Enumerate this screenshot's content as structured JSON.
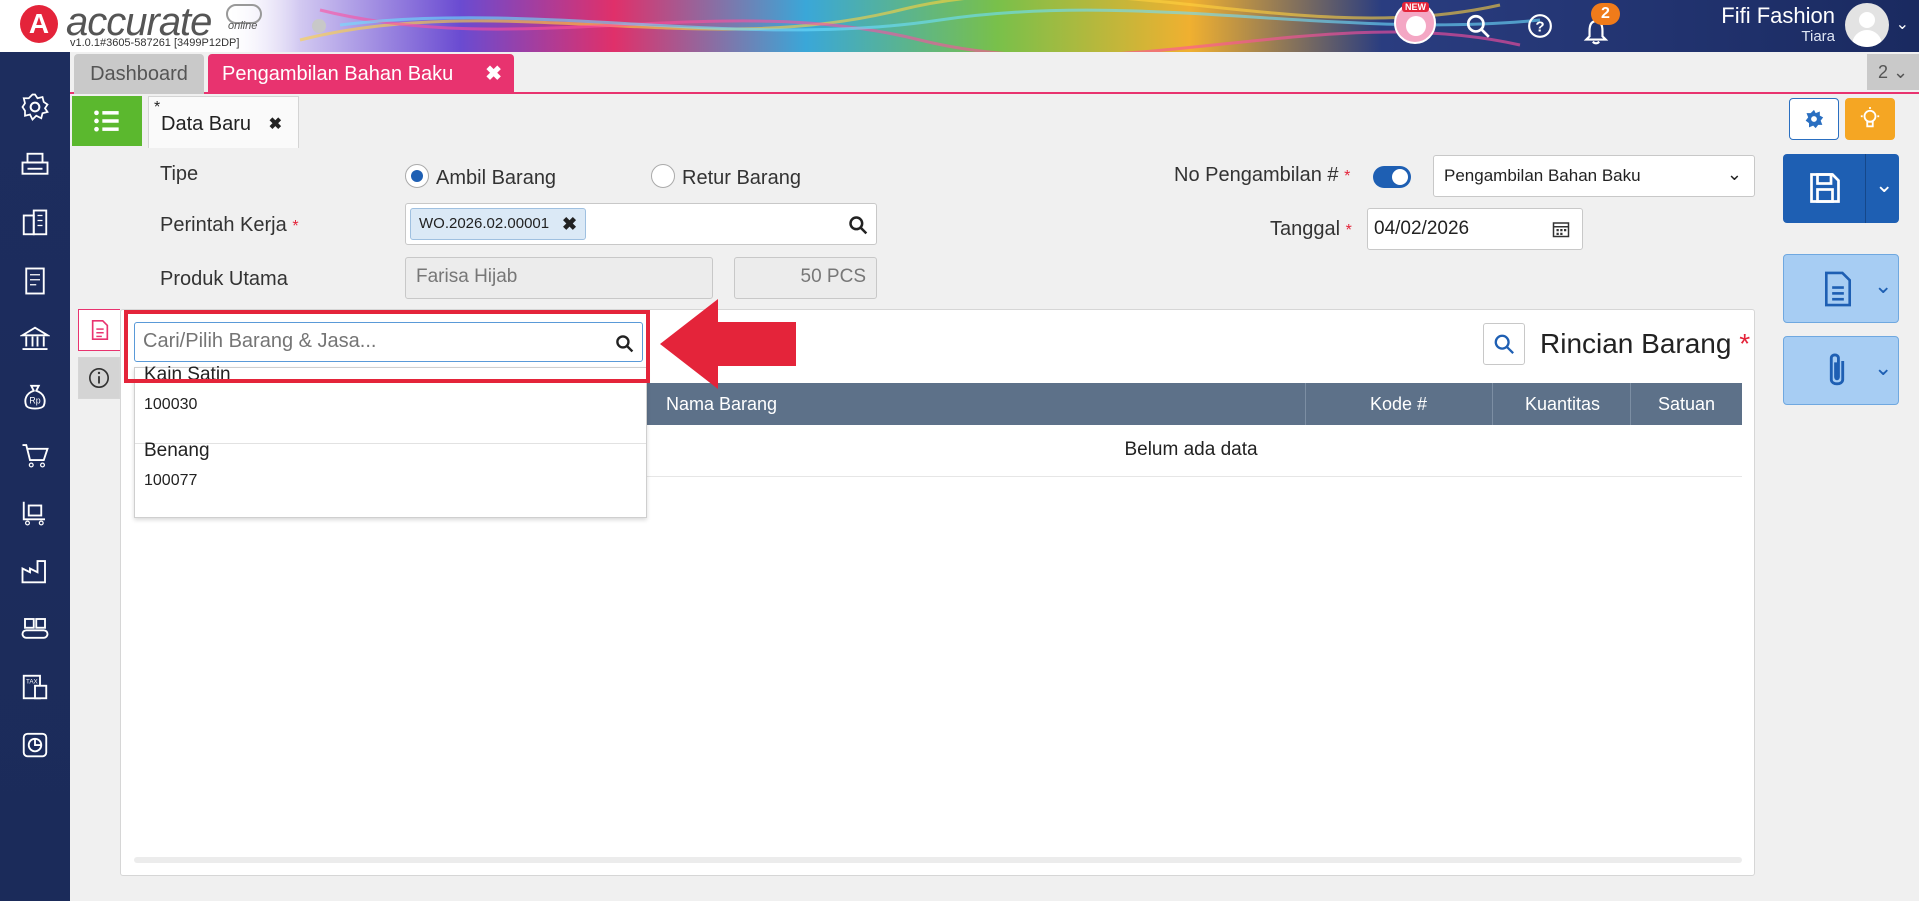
{
  "header": {
    "logo_text": "accurate",
    "logo_sub": "online",
    "version": "v1.0.1#3605-587261 [3499P12DP]",
    "new_badge": "NEW",
    "notification_count": "2",
    "company": "Fifi Fashion",
    "user": "Tiara"
  },
  "tabs": {
    "dashboard": "Dashboard",
    "active": "Pengambilan Bahan Baku",
    "count": "2"
  },
  "form_tab": {
    "label": "Data Baru",
    "marker": "*"
  },
  "form": {
    "tipe_label": "Tipe",
    "tipe_options": [
      "Ambil Barang",
      "Retur Barang"
    ],
    "tipe_selected": "Ambil Barang",
    "perintah_label": "Perintah Kerja",
    "perintah_value": "WO.2026.02.00001",
    "produk_label": "Produk Utama",
    "produk_value": "Farisa Hijab",
    "produk_qty": "50 PCS",
    "no_label": "No Pengambilan #",
    "no_select": "Pengambilan Bahan Baku",
    "tanggal_label": "Tanggal",
    "tanggal_value": "04/02/2026",
    "required_mark": "*"
  },
  "detail": {
    "title": "Rincian Barang",
    "search_placeholder": "Cari/Pilih Barang & Jasa...",
    "columns": [
      "Nama Barang",
      "Kode #",
      "Kuantitas",
      "Satuan"
    ],
    "empty_text": "Belum ada data",
    "dropdown_items": [
      {
        "name": "Kain Satin",
        "code": "100030"
      },
      {
        "name": "Benang",
        "code": "100077"
      }
    ]
  },
  "colors": {
    "brand_red": "#e4243a",
    "tab_pink": "#e8336f",
    "primary_blue": "#1e5fb3",
    "sidebar_navy": "#1d2d5e",
    "table_header": "#5d7189",
    "green": "#5bb82e",
    "orange": "#f5a623"
  },
  "icons": {
    "sidebar": [
      "gear-icon",
      "printer-icon",
      "building-icon",
      "ledger-icon",
      "bank-icon",
      "money-bag-icon",
      "cart-icon",
      "shopping-trolley-icon",
      "factory-icon",
      "conveyor-icon",
      "tax-icon",
      "report-chart-icon"
    ]
  }
}
